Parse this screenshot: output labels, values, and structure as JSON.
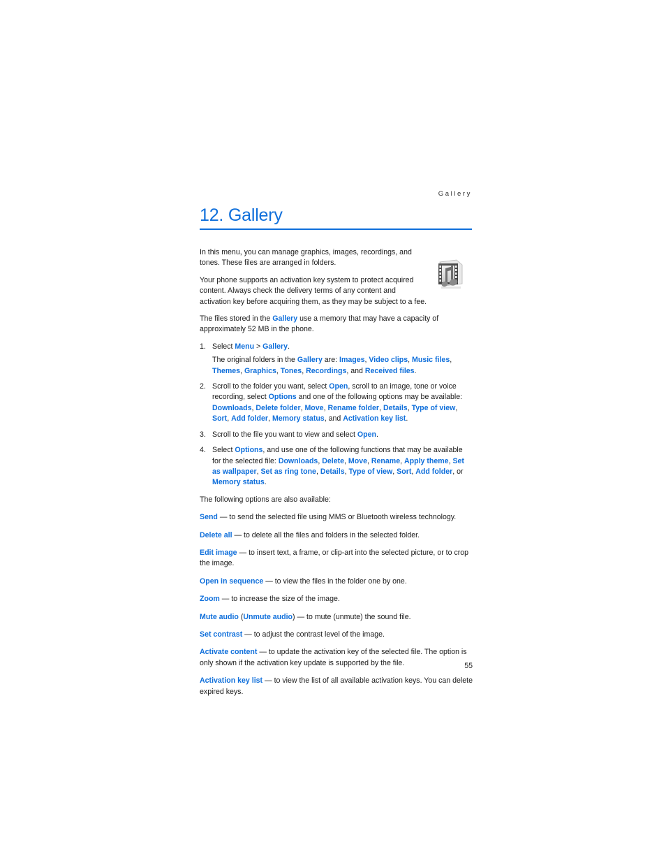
{
  "page": {
    "running_header": "Gallery",
    "folio": "55"
  },
  "heading": {
    "number": "12.",
    "title": "Gallery",
    "full": "12. Gallery",
    "color": "#0f6fdb"
  },
  "icon": {
    "name": "film-strip-music-note-icon",
    "description": "Grayscale film strip with musical note"
  },
  "intro": {
    "para1": "In this menu, you can manage graphics, images, recordings, and tones. These files are arranged in folders.",
    "para2": "Your phone supports an activation key system to protect acquired content. Always check the delivery terms of any content and activation key before acquiring them, as they may be subject to a fee.",
    "para3_before": "The files stored in the ",
    "para3_keyword": "Gallery",
    "para3_after": " use a memory that may have a capacity of approximately 52 MB in the phone."
  },
  "steps": [
    {
      "num": "1.",
      "line1_a": "Select ",
      "line1_kw1": "Menu",
      "line1_b": " > ",
      "line1_kw2": "Gallery",
      "line1_c": ".",
      "sub_a": "The original folders in the ",
      "sub_kw1": "Gallery",
      "sub_b": " are: ",
      "sub_list": [
        "Images",
        "Video clips",
        "Music files",
        "Themes",
        "Graphics",
        "Tones",
        "Recordings",
        "Received files"
      ],
      "sub_tail": "."
    },
    {
      "num": "2.",
      "a": "Scroll to the folder you want, select ",
      "kw1": "Open",
      "b": ", scroll to an image, tone or voice recording, select ",
      "kw2": "Options",
      "c": " and one of the following options may be available: ",
      "list": [
        "Downloads",
        "Delete folder",
        "Move",
        "Rename folder",
        "Details",
        "Type of view",
        "Sort",
        "Add folder",
        "Memory status",
        "Activation key list"
      ],
      "tail": "."
    },
    {
      "num": "3.",
      "a": "Scroll to the file you want to view and select ",
      "kw1": "Open",
      "b": "."
    },
    {
      "num": "4.",
      "a": "Select ",
      "kw1": "Options",
      "b": ", and use one of the following functions that may be available for the selected file: ",
      "list": [
        "Downloads",
        "Delete",
        "Move",
        "Rename",
        "Apply theme",
        "Set as wallpaper",
        "Set as ring tone",
        "Details",
        "Type of view",
        "Sort",
        "Add folder",
        "Memory status"
      ],
      "tail": "."
    }
  ],
  "options_intro": "The following options are also available:",
  "options": [
    {
      "term": "Send",
      "dash": " — ",
      "desc": "to send the selected file using MMS or Bluetooth wireless technology."
    },
    {
      "term": "Delete all",
      "dash": " — ",
      "desc": "to delete all the files and folders in the selected folder."
    },
    {
      "term": "Edit image",
      "dash": " — ",
      "desc": "to insert text, a frame, or clip-art into the selected picture, or to crop the image."
    },
    {
      "term": "Open in sequence",
      "dash": " — ",
      "desc": "to view the files in the folder one by one."
    },
    {
      "term": "Zoom",
      "dash": " — ",
      "desc": "to increase the size of the image."
    },
    {
      "term": "Mute audio",
      "term2": "Unmute audio",
      "open_paren": " (",
      "close_paren": ")",
      "dash": " — ",
      "desc": "to mute (unmute) the sound file."
    },
    {
      "term": "Set contrast",
      "dash": " — ",
      "desc": "to adjust the contrast level of the image."
    },
    {
      "term": "Activate content",
      "dash": " — ",
      "desc": "to update the activation key of the selected file. The option is only shown if the activation key update is supported by the file."
    },
    {
      "term": "Activation key list",
      "dash": " — ",
      "desc": "to view the list of all available activation keys. You can delete expired keys."
    }
  ]
}
